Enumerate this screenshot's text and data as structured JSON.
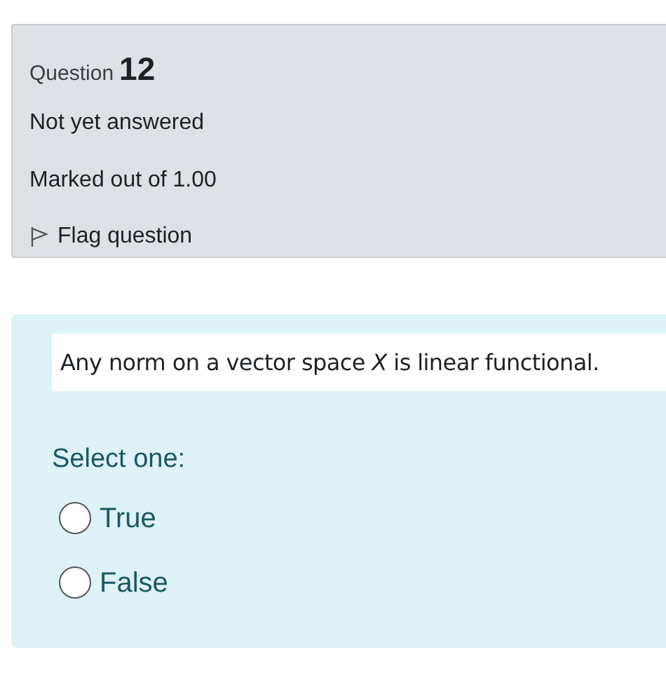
{
  "info": {
    "label": "Question",
    "number": "12",
    "status": "Not yet answered",
    "marks": "Marked out of 1.00",
    "flag": {
      "label": "Flag question",
      "flagged": false
    }
  },
  "question": {
    "text": "Any norm on a vector space *X* is linear functional.",
    "prompt": "Select one:",
    "options": [
      {
        "label": "True",
        "selected": false
      },
      {
        "label": "False",
        "selected": false
      }
    ]
  }
}
